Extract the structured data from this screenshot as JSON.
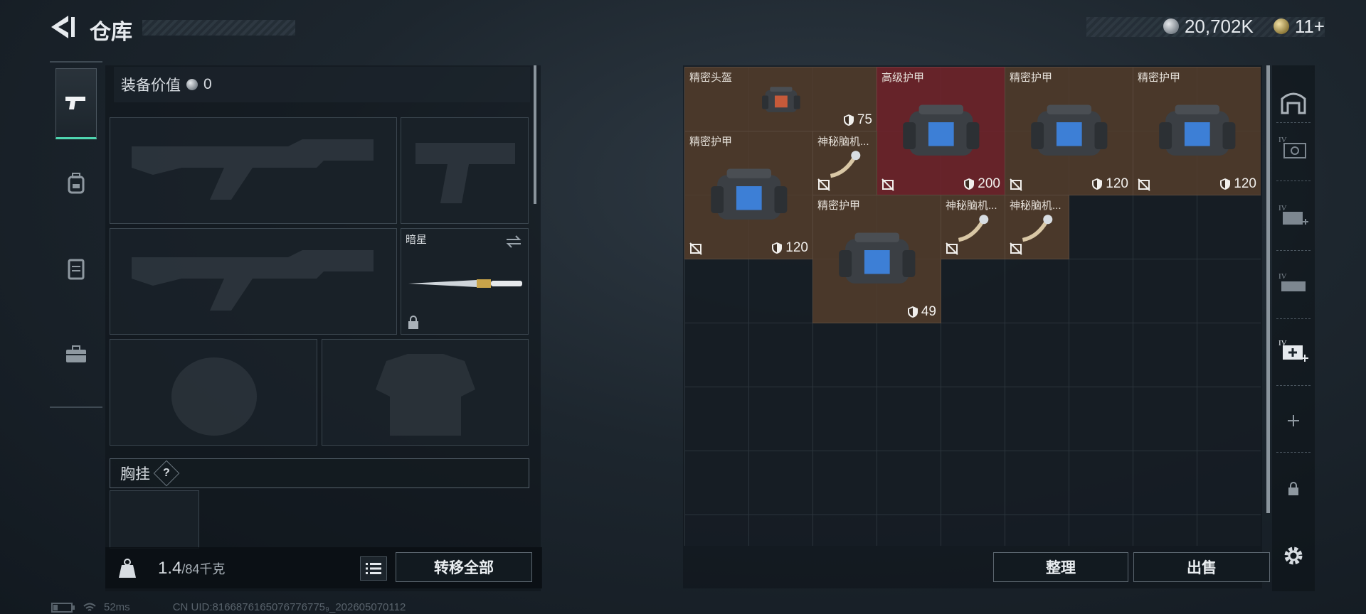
{
  "header": {
    "title": "仓库",
    "back_icon": "back-arrow-icon"
  },
  "currency": {
    "silver_value": "20,702K",
    "gold_value": "11+"
  },
  "equip": {
    "value_label": "装备价值",
    "value": "0",
    "knife_name": "暗星",
    "chest_label": "胸挂",
    "help_symbol": "?",
    "weight_current": "1.4",
    "weight_max": "/84千克",
    "transfer_all": "转移全部"
  },
  "grid": {
    "items": [
      {
        "name": "精密头盔",
        "value": "75",
        "color": "brown"
      },
      {
        "name": "高级护甲",
        "value": "200",
        "color": "red"
      },
      {
        "name": "精密护甲",
        "value": "120",
        "color": "brown"
      },
      {
        "name": "精密护甲",
        "value": "120",
        "color": "brown"
      },
      {
        "name": "精密护甲",
        "value": "120",
        "color": "brown"
      },
      {
        "name": "神秘脑机...",
        "value": "",
        "color": "brown"
      },
      {
        "name": "精密护甲",
        "value": "49",
        "color": "brown"
      },
      {
        "name": "神秘脑机...",
        "value": "",
        "color": "brown"
      },
      {
        "name": "神秘脑机...",
        "value": "",
        "color": "brown"
      }
    ],
    "sort_label": "整理",
    "sell_label": "出售"
  },
  "status": {
    "ping": "52ms",
    "uid": "CN UID:8166876165076776775₉_202605070112"
  },
  "icons": [
    "back-arrow-icon",
    "silver-coin-icon",
    "gold-coin-icon",
    "pistol-icon",
    "backpack-icon",
    "rig-icon",
    "toolbox-icon",
    "shield-icon",
    "settings-icon",
    "lock-icon",
    "plus-icon",
    "list-icon",
    "kg-weight-icon"
  ]
}
